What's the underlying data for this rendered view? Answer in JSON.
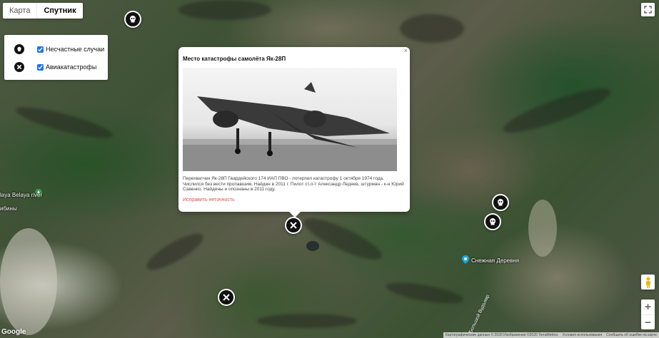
{
  "map_type": {
    "map_label": "Карта",
    "satellite_label": "Спутник"
  },
  "legend": [
    {
      "label": "Несчастные случаи",
      "icon": "skull-icon",
      "checked": true
    },
    {
      "label": "Авиакатастрофы",
      "icon": "crossed-tools-icon",
      "checked": true
    }
  ],
  "popup": {
    "title": "Место катастрофы самолёта Як-28П",
    "close": "×",
    "description": "Перехватчик Як-28П Гвардейского 174 ИАП ПВО - потерпел катастрофу 1 октября 1974 года. Числился без вести пропавшим. Найден в 2011 г. Пилот ст.л-т Александр Ледяев, штурман - к-н Юрий Савенко. Найдены и опознаны в 2011 году.",
    "fix_link": "Исправить неточность"
  },
  "map_labels": {
    "river": "laya Belaya river",
    "kiny": "ибины",
    "village": "Снежная Деревня",
    "road": "Большой Вудъявр"
  },
  "zoom": {
    "in": "+",
    "out": "−"
  },
  "google": "Google",
  "attribution": {
    "data": "Картографические данные © 2020 Изображения ©2020 TerraMetrics",
    "terms": "Условия использования",
    "report": "Сообщить об ошибке на карте"
  }
}
